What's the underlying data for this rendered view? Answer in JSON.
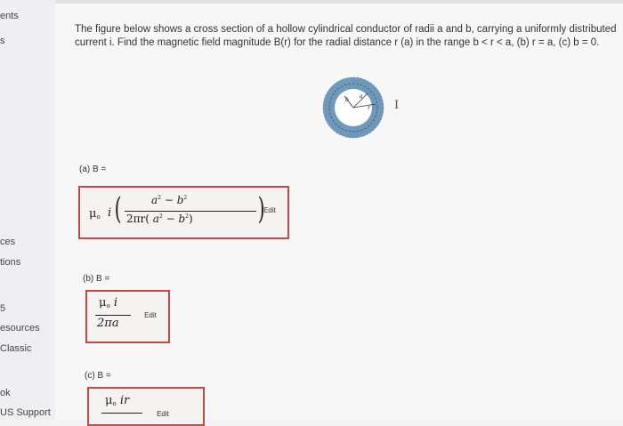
{
  "sidebar": {
    "items": [
      {
        "label": "ents"
      },
      {
        "label": "s"
      },
      {
        "label": "ces"
      },
      {
        "label": "tions"
      },
      {
        "label": "5"
      },
      {
        "label": "esources"
      },
      {
        "label": "Classic"
      },
      {
        "label": "ok"
      },
      {
        "label": "US Support"
      }
    ]
  },
  "question": {
    "line1": "The figure below shows a cross section of a hollow cylindrical conductor of radii a and b, carrying a uniformly distributed",
    "line2": "current i. Find the magnetic field magnitude B(r) for the radial distance r (a) in the range b < r < a, (b) r = a, (c) b = 0."
  },
  "figure": {
    "labels": {
      "a": "a",
      "b": "b",
      "r": "r"
    },
    "colors": {
      "ring": "#6f98b9",
      "inner": "#ffffff"
    }
  },
  "cursor": {
    "glyph": "I"
  },
  "parts": {
    "a": {
      "label": "(a) B =",
      "mu": "μ",
      "naught": "o",
      "current": "i",
      "num_a": "a",
      "num_b": "b",
      "minus": "−",
      "den_prefix": "2πr(",
      "den_a": "a",
      "den_b": "b",
      "den_suffix": ")",
      "exp": "2",
      "edit": "Edit"
    },
    "b": {
      "label": "(b) B =",
      "mu": "μ",
      "naught": "o",
      "current": "i",
      "den": "2πa",
      "edit": "Edit"
    },
    "c": {
      "label": "(c) B =",
      "mu": "μ",
      "naught": "o",
      "num_rest": "ir",
      "edit": "Edit"
    }
  },
  "colors": {
    "answer_border": "#c24a45"
  }
}
